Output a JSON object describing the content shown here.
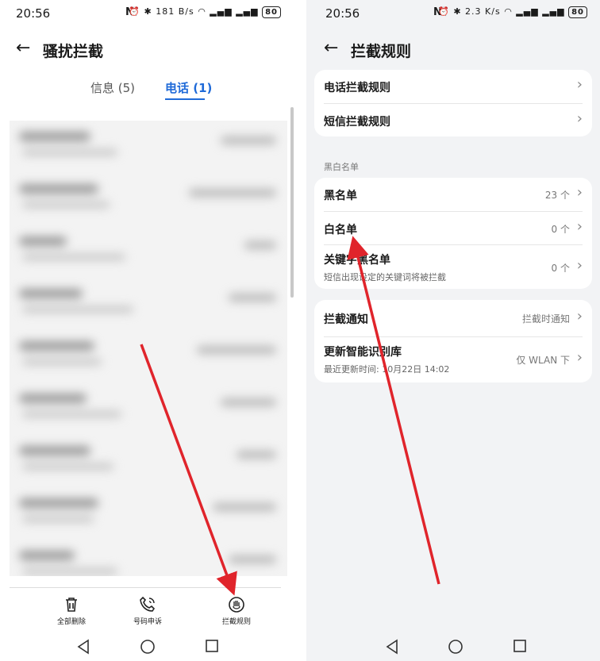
{
  "left": {
    "status": {
      "time": "20:56",
      "nfc": "N",
      "net_speed": "181 B/s",
      "battery": "80"
    },
    "header": {
      "title": "骚扰拦截"
    },
    "tabs": [
      {
        "label": "信息 (5)"
      },
      {
        "label": "电话 (1)",
        "selected": true
      }
    ],
    "bottom_actions": [
      {
        "label": "全部删除",
        "icon": "trash-icon"
      },
      {
        "label": "号码申诉",
        "icon": "phone-appeal-icon"
      },
      {
        "label": "拦截规则",
        "icon": "block-rules-icon"
      }
    ]
  },
  "right": {
    "status": {
      "time": "20:56",
      "nfc": "N",
      "net_speed": "2.3 K/s",
      "battery": "80"
    },
    "header": {
      "title": "拦截规则"
    },
    "rules": [
      {
        "label": "电话拦截规则"
      },
      {
        "label": "短信拦截规则"
      }
    ],
    "section_title": "黑白名单",
    "lists": [
      {
        "label": "黑名单",
        "value": "23 个"
      },
      {
        "label": "白名单",
        "value": "0 个"
      },
      {
        "label": "关键字黑名单",
        "sub": "短信出现设定的关键词将被拦截",
        "value": "0 个"
      }
    ],
    "notify": {
      "label": "拦截通知",
      "value": "拦截时通知"
    },
    "update": {
      "label": "更新智能识别库",
      "sub": "最近更新时间: 10月22日 14:02",
      "value": "仅 WLAN 下"
    }
  },
  "colors": {
    "accent": "#1f6ad8",
    "annotation_arrow": "#e0242b",
    "background": "#f2f3f5"
  }
}
